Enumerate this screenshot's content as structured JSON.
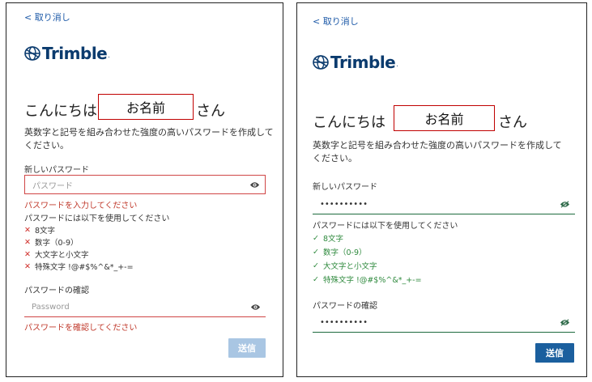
{
  "cancel": "< 取り消し",
  "logo": {
    "brand": "Trimble",
    "dot": "."
  },
  "greeting": {
    "prefix": "こんにちは",
    "name": "お名前",
    "suffix": "さん"
  },
  "description_line1": "英数字と記号を組み合わせた強度の高いパスワードを作成して",
  "description_line2": "ください。",
  "new_password_label": "新しいパスワード",
  "confirm_label": "パスワードの確認",
  "submit_label": "送信",
  "rules_title": "パスワードには以下を使用してください",
  "rules": [
    "8文字",
    "数字（0-9）",
    "大文字と小文字",
    "特殊文字 !@#$%^&*_+-="
  ],
  "left": {
    "new_placeholder": "パスワード",
    "new_error": "パスワードを入力してください",
    "confirm_placeholder": "Password",
    "confirm_error": "パスワードを確認してください"
  },
  "right": {
    "new_value": "••••••••••",
    "confirm_value": "••••••••••"
  },
  "colors": {
    "error": "#d04646",
    "ok": "#1e6b3e",
    "button_active": "#1b5f9e",
    "button_disabled": "#a9c6e3"
  }
}
